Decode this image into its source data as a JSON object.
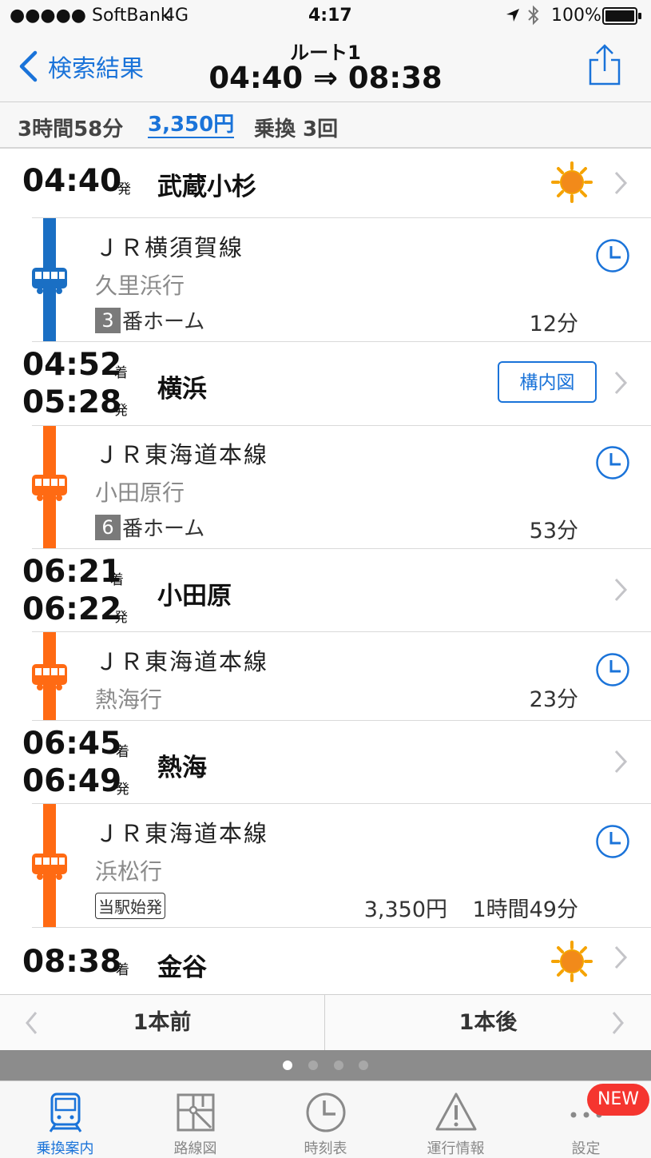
{
  "status_bar": {
    "carrier": "●●●●● SoftBank",
    "network": "4G",
    "time": "4:17",
    "battery": "100%"
  },
  "nav": {
    "back_label": "検索結果",
    "route_title": "ルート1",
    "route_times": "04:40 ⇒ 08:38"
  },
  "summary": {
    "duration": "3時間58分",
    "fare": "3,350円",
    "transfers": "乗換 3回"
  },
  "stations": [
    {
      "times": [
        {
          "time": "04:40",
          "suffix": "発"
        }
      ],
      "name": "武蔵小杉",
      "weather": "sun-icon"
    },
    {
      "times": [
        {
          "time": "04:52",
          "suffix": "着"
        },
        {
          "time": "05:28",
          "suffix": "発"
        }
      ],
      "name": "横浜",
      "map_button": "構内図"
    },
    {
      "times": [
        {
          "time": "06:21",
          "suffix": "着"
        },
        {
          "time": "06:22",
          "suffix": "発"
        }
      ],
      "name": "小田原"
    },
    {
      "times": [
        {
          "time": "06:45",
          "suffix": "着"
        },
        {
          "time": "06:49",
          "suffix": "発"
        }
      ],
      "name": "熱海"
    },
    {
      "times": [
        {
          "time": "08:38",
          "suffix": "着"
        }
      ],
      "name": "金谷",
      "weather": "sun-icon"
    }
  ],
  "segments": [
    {
      "line": "ＪＲ横須賀線",
      "dest": "久里浜行",
      "platform_num": "3",
      "platform_label": "番ホーム",
      "duration": "12分",
      "color": "#1a6fc4"
    },
    {
      "line": "ＪＲ東海道本線",
      "dest": "小田原行",
      "platform_num": "6",
      "platform_label": "番ホーム",
      "duration": "53分",
      "color": "#ff6a13"
    },
    {
      "line": "ＪＲ東海道本線",
      "dest": "熱海行",
      "duration": "23分",
      "color": "#ff6a13"
    },
    {
      "line": "ＪＲ東海道本線",
      "dest": "浜松行",
      "badge": "当駅始発",
      "fare": "3,350円",
      "duration": "1時間49分",
      "color": "#ff6a13"
    }
  ],
  "pager": {
    "prev": "1本前",
    "next": "1本後"
  },
  "tabs": [
    {
      "label": "乗換案内",
      "icon": "train-icon",
      "active": true
    },
    {
      "label": "路線図",
      "icon": "route-map-icon"
    },
    {
      "label": "時刻表",
      "icon": "clock-icon"
    },
    {
      "label": "運行情報",
      "icon": "warning-icon"
    },
    {
      "label": "設定",
      "icon": "more-icon",
      "badge": "NEW"
    }
  ],
  "colors": {
    "accent": "#1a73d9",
    "orange": "#ff6a13",
    "blue_line": "#1a6fc4",
    "new_badge": "#f5352f"
  }
}
